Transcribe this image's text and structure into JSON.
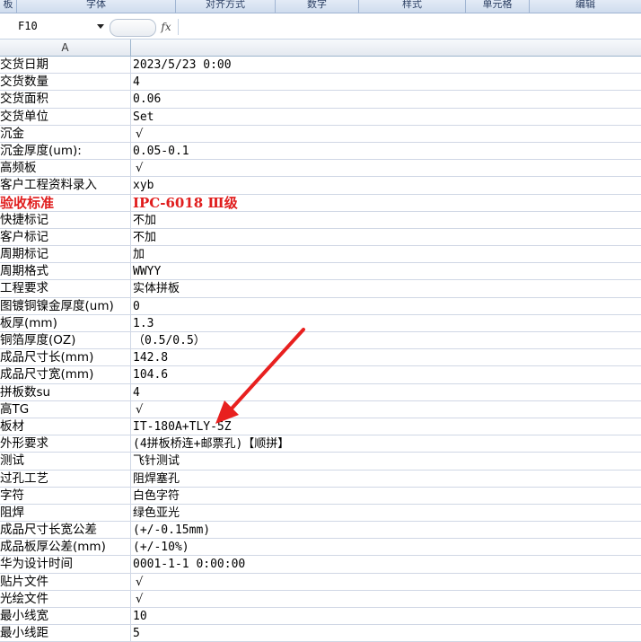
{
  "ribbon": {
    "groups": [
      "板",
      "字体",
      "对齐方式",
      "数字",
      "样式",
      "单元格",
      "编辑"
    ]
  },
  "formula_bar": {
    "name_box": "F10",
    "fx_label": "fx",
    "formula": ""
  },
  "columns": {
    "a": "A"
  },
  "rows": [
    {
      "label": "交货日期",
      "value": "2023/5/23 0:00"
    },
    {
      "label": "交货数量",
      "value": "4"
    },
    {
      "label": "交货面积",
      "value": "0.06"
    },
    {
      "label": "交货单位",
      "value": "Set"
    },
    {
      "label": "沉金",
      "value": "√"
    },
    {
      "label": "沉金厚度(um):",
      "value": "0.05-0.1"
    },
    {
      "label": "高频板",
      "value": "√"
    },
    {
      "label": "客户工程资料录入",
      "value": "xyb"
    },
    {
      "label": "验收标准",
      "value": "IPC-6018 Ⅲ级"
    },
    {
      "label": "快捷标记",
      "value": "不加"
    },
    {
      "label": "客户标记",
      "value": "不加"
    },
    {
      "label": "周期标记",
      "value": "加"
    },
    {
      "label": "周期格式",
      "value": "WWYY"
    },
    {
      "label": "工程要求",
      "value": "实体拼板"
    },
    {
      "label": "图镀铜镍金厚度(um)",
      "value": "0"
    },
    {
      "label": "板厚(mm)",
      "value": "1.3"
    },
    {
      "label": "铜箔厚度(OZ)",
      "value": "（0.5/0.5）"
    },
    {
      "label": "成品尺寸长(mm)",
      "value": "142.8"
    },
    {
      "label": "成品尺寸宽(mm)",
      "value": "104.6"
    },
    {
      "label": "拼板数su",
      "value": "4"
    },
    {
      "label": "高TG",
      "value": "√"
    },
    {
      "label": "板材",
      "value": "IT-180A+TLY-5Z"
    },
    {
      "label": "外形要求",
      "value": "(4拼板桥连+邮票孔)【顺拼】"
    },
    {
      "label": "测试",
      "value": "飞针测试"
    },
    {
      "label": "过孔工艺",
      "value": "阻焊塞孔"
    },
    {
      "label": "字符",
      "value": "白色字符"
    },
    {
      "label": "阻焊",
      "value": "绿色亚光"
    },
    {
      "label": "成品尺寸长宽公差",
      "value": "(+/-0.15mm)"
    },
    {
      "label": "成品板厚公差(mm)",
      "value": "(+/-10%)"
    },
    {
      "label": "华为设计时间",
      "value": "0001-1-1 0:00:00"
    },
    {
      "label": "贴片文件",
      "value": "√"
    },
    {
      "label": "光绘文件",
      "value": "√"
    },
    {
      "label": "最小线宽",
      "value": "10"
    },
    {
      "label": "最小线距",
      "value": "5"
    }
  ],
  "colors": {
    "highlight_text": "#e01d1d",
    "arrow": "#e8201f",
    "grid_line": "#d0d7e5"
  },
  "annotation": {
    "type": "red-arrow",
    "points_to_row": "板材"
  }
}
